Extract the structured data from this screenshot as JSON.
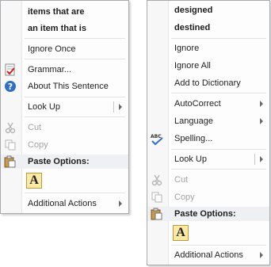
{
  "menu_left": {
    "suggestions": [
      "items that are",
      "an item that is"
    ],
    "ignore_once": "Ignore Once",
    "grammar": "Grammar...",
    "about": "About This Sentence",
    "look_up": "Look Up",
    "cut": "Cut",
    "copy": "Copy",
    "paste_options": "Paste Options:",
    "paste_keep_text": "A",
    "additional_actions": "Additional Actions"
  },
  "menu_right": {
    "suggestions": [
      "designed",
      "destined"
    ],
    "ignore": "Ignore",
    "ignore_all": "Ignore All",
    "add_to_dictionary": "Add to Dictionary",
    "autocorrect": "AutoCorrect",
    "language": "Language",
    "spelling": "Spelling...",
    "look_up": "Look Up",
    "cut": "Cut",
    "copy": "Copy",
    "paste_options": "Paste Options:",
    "paste_keep_text": "A",
    "additional_actions": "Additional Actions"
  },
  "icons": {
    "grammar": "grammar-check-icon",
    "about": "help-icon",
    "cut": "scissors-icon",
    "copy": "copy-icon",
    "paste": "paste-icon",
    "spelling": "abc-spelling-icon"
  },
  "colors": {
    "help_blue": "#2f6fc4",
    "paste_yellow": "#fbe9a8",
    "disabled": "#a3a3a3"
  }
}
